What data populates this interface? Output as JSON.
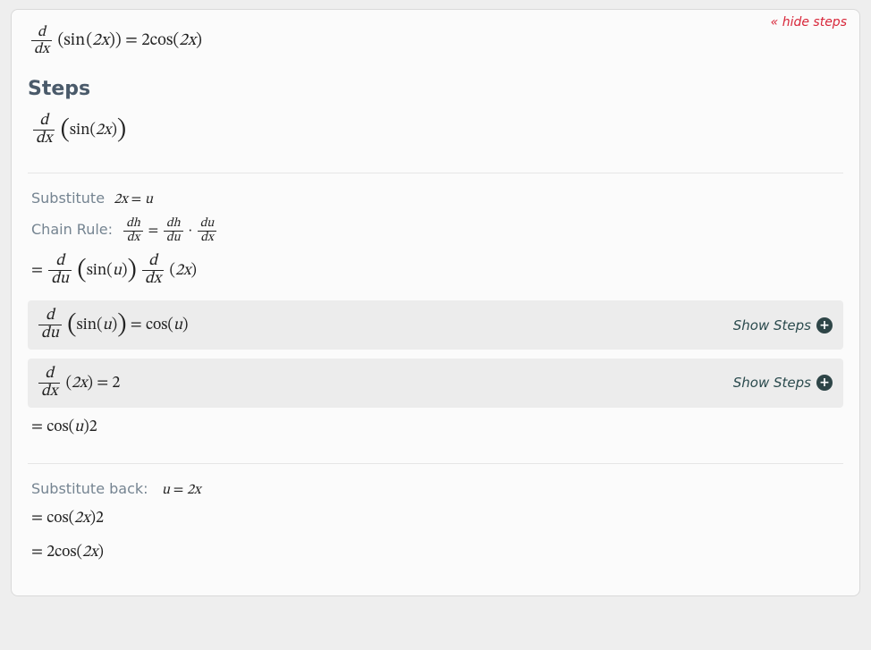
{
  "header": {
    "hide_steps_label": "« hide steps"
  },
  "result": {
    "d": "d",
    "dx": "dx",
    "fn": "sin",
    "arg_open": "(",
    "arg": "2x",
    "arg_close": ")",
    "eq": " = ",
    "rhs_coeff": "2",
    "rhs_fn": "cos",
    "rhs_arg": "2x"
  },
  "steps_heading": "Steps",
  "step0": {
    "d": "d",
    "dx": "dx",
    "fn": "sin",
    "arg": "2x"
  },
  "notes": {
    "substitute_label": "Substitute",
    "substitute_expr_lhs": "2x",
    "substitute_expr_eq": " = ",
    "substitute_expr_rhs": "u",
    "chain_label": "Chain Rule:",
    "chain_dh": "dh",
    "chain_dx": "dx",
    "chain_du": "du",
    "chain_eq": " = ",
    "chain_dot": " · "
  },
  "step_chain_expand": {
    "eq": "= ",
    "d": "d",
    "du": "du",
    "dx": "dx",
    "fn1": "sin",
    "arg1": "u",
    "arg2": "2x"
  },
  "sub1": {
    "d": "d",
    "du": "du",
    "fn": "sin",
    "arg": "u",
    "eq": " = ",
    "rhs_fn": "cos",
    "rhs_arg": "u",
    "show_label": "Show Steps"
  },
  "sub2": {
    "d": "d",
    "dx": "dx",
    "arg": "2x",
    "eq": " = ",
    "rhs": "2",
    "show_label": "Show Steps"
  },
  "step_combined": {
    "eq": "= ",
    "fn": "cos",
    "arg": "u",
    "coeff": "2"
  },
  "notes2": {
    "sub_back_label": "Substitute back:",
    "sub_back_lhs": "u",
    "sub_back_eq": " = ",
    "sub_back_rhs": "2x"
  },
  "step_back1": {
    "eq": "= ",
    "fn": "cos",
    "arg": "2x",
    "coeff": "2"
  },
  "step_back2": {
    "eq": "= ",
    "coeff": "2",
    "fn": "cos",
    "arg": "2x"
  }
}
